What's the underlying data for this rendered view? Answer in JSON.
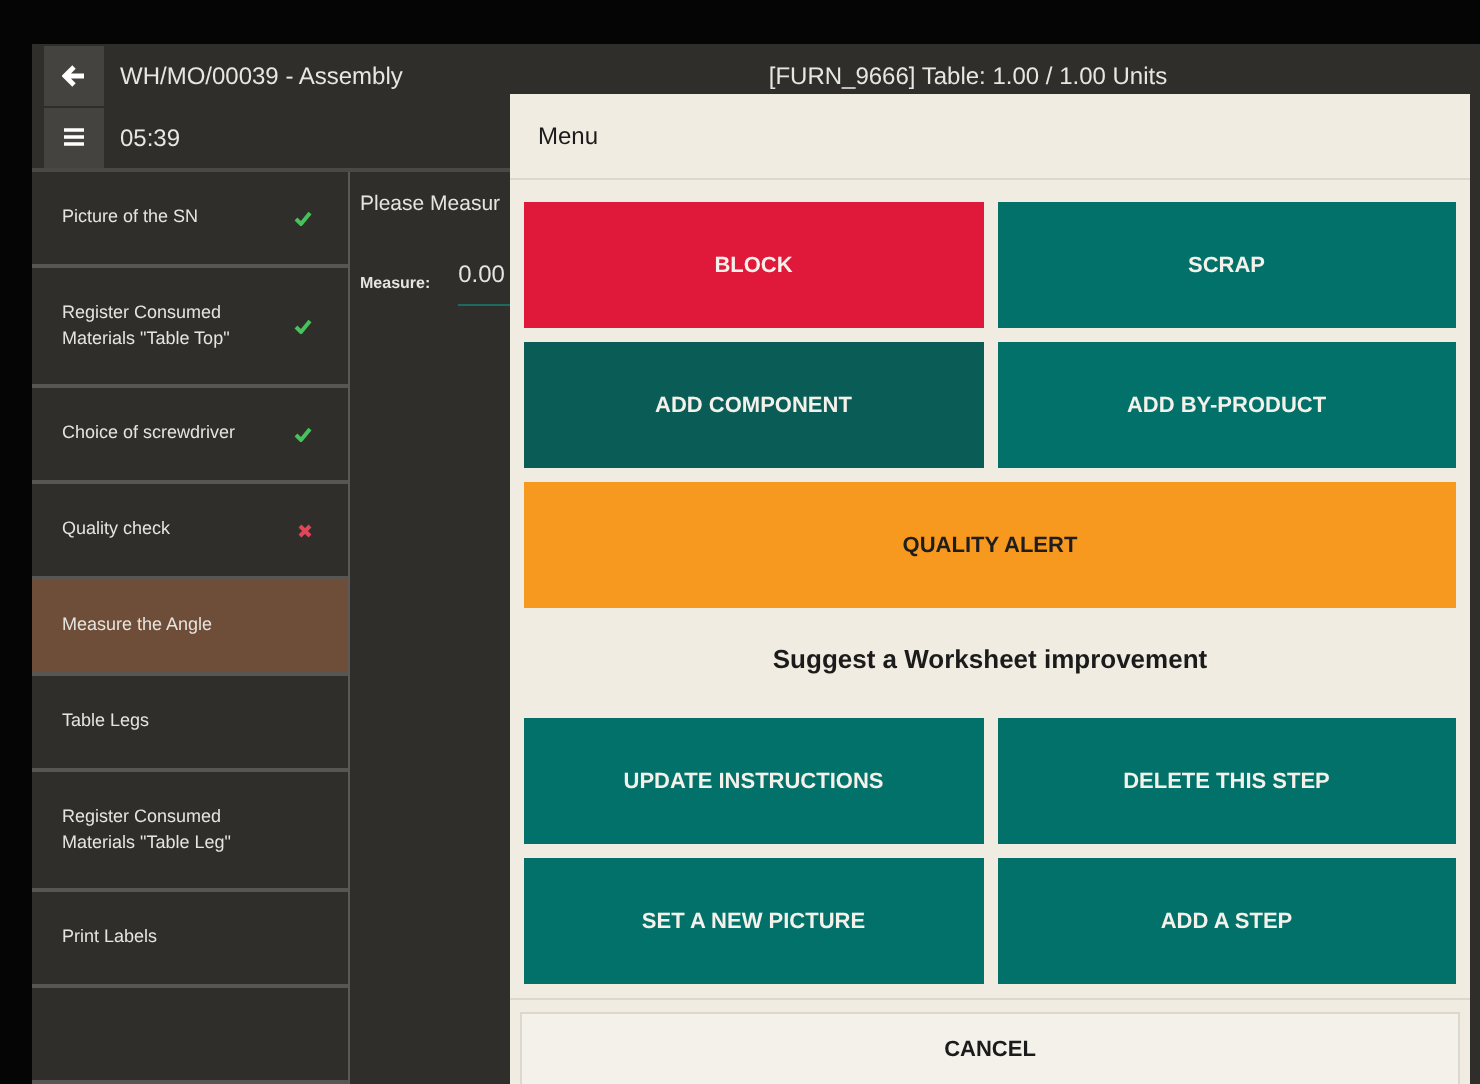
{
  "header": {
    "title": "WH/MO/00039 - Assembly",
    "product": "[FURN_9666] Table: 1.00 / 1.00 Units",
    "timer": "05:39"
  },
  "steps": [
    {
      "label": "Picture of the SN",
      "passed": true,
      "failed": false,
      "selected": false
    },
    {
      "label": "Register Consumed Materials \"Table Top\"",
      "passed": true,
      "failed": false,
      "selected": false
    },
    {
      "label": "Choice of screwdriver",
      "passed": true,
      "failed": false,
      "selected": false
    },
    {
      "label": "Quality check",
      "passed": false,
      "failed": true,
      "selected": false
    },
    {
      "label": "Measure the Angle",
      "passed": false,
      "failed": false,
      "selected": true
    },
    {
      "label": "Table Legs",
      "passed": false,
      "failed": false,
      "selected": false
    },
    {
      "label": "Register Consumed Materials \"Table Leg\"",
      "passed": false,
      "failed": false,
      "selected": false
    },
    {
      "label": "Print Labels",
      "passed": false,
      "failed": false,
      "selected": false
    }
  ],
  "content": {
    "instruction": "Please Measur",
    "measure_label": "Measure:",
    "measure_value": "0.00"
  },
  "menu": {
    "title": "Menu",
    "actions": [
      {
        "label": "BLOCK",
        "kind": "danger"
      },
      {
        "label": "SCRAP",
        "kind": "primary"
      },
      {
        "label": "ADD COMPONENT",
        "kind": "secondary"
      },
      {
        "label": "ADD BY-PRODUCT",
        "kind": "primary"
      },
      {
        "label": "QUALITY ALERT",
        "kind": "warning"
      }
    ],
    "suggest_title": "Suggest a Worksheet improvement",
    "suggestions": [
      {
        "label": "UPDATE INSTRUCTIONS",
        "kind": "primary"
      },
      {
        "label": "DELETE THIS STEP",
        "kind": "primary"
      },
      {
        "label": "SET A NEW PICTURE",
        "kind": "primary"
      },
      {
        "label": "ADD A STEP",
        "kind": "primary"
      }
    ],
    "cancel": "CANCEL"
  }
}
